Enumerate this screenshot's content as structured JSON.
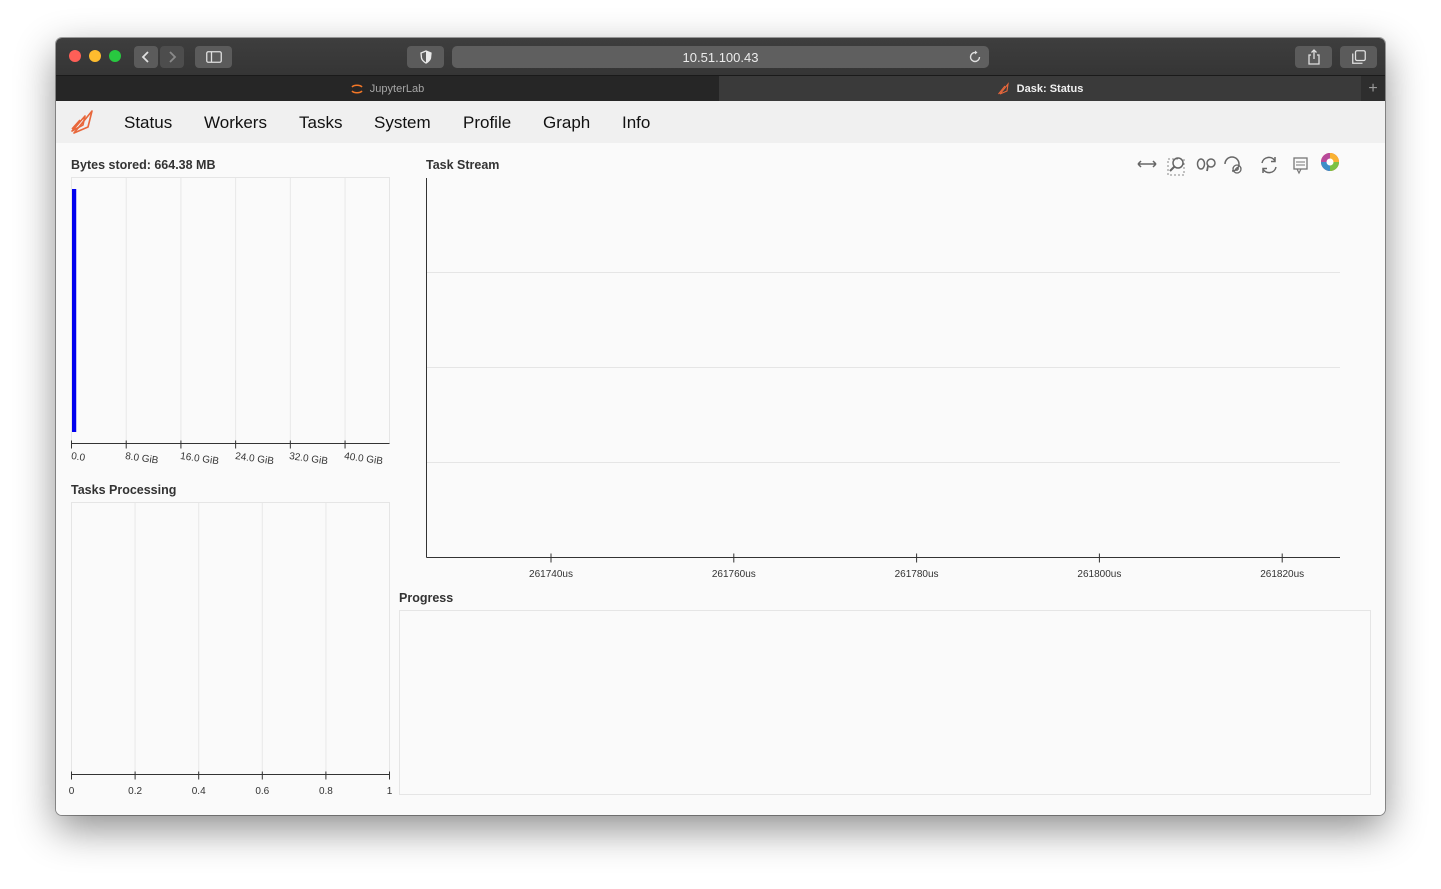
{
  "browser": {
    "url": "10.51.100.43",
    "tabs": [
      {
        "label": "JupyterLab",
        "active": false
      },
      {
        "label": "Dask: Status",
        "active": true
      }
    ],
    "new_tab_symbol": "+"
  },
  "nav": {
    "items": [
      "Status",
      "Workers",
      "Tasks",
      "System",
      "Profile",
      "Graph",
      "Info"
    ]
  },
  "panels": {
    "bytes_stored": {
      "title": "Bytes stored: 664.38 MB",
      "ticks": [
        "0.0",
        "8.0 GiB",
        "16.0 GiB",
        "24.0 GiB",
        "32.0 GiB",
        "40.0 GiB"
      ]
    },
    "tasks_processing": {
      "title": "Tasks Processing",
      "ticks": [
        "0",
        "0.2",
        "0.4",
        "0.6",
        "0.8",
        "1"
      ]
    },
    "task_stream": {
      "title": "Task Stream",
      "ticks": [
        "261740us",
        "261760us",
        "261780us",
        "261800us",
        "261820us"
      ]
    },
    "progress": {
      "title": "Progress"
    }
  },
  "toolbar_icons": [
    "pan-icon",
    "box-zoom-icon",
    "wheel-zoom-icon",
    "zoom-in-icon",
    "reset-icon",
    "hover-icon",
    "bokeh-logo-icon"
  ],
  "colors": {
    "accent": "#1f77b4",
    "bar": "#0000ee",
    "dask_orange": "#e8673b"
  },
  "chart_data": [
    {
      "type": "bar",
      "title": "Bytes stored: 664.38 MB",
      "orientation": "horizontal",
      "x_ticks": [
        "0.0",
        "8.0 GiB",
        "16.0 GiB",
        "24.0 GiB",
        "32.0 GiB",
        "40.0 GiB"
      ],
      "xlim": [
        0,
        46.5
      ],
      "values": [
        0.62
      ],
      "grid": true
    },
    {
      "type": "bar",
      "title": "Tasks Processing",
      "orientation": "horizontal",
      "x_ticks": [
        "0",
        "0.2",
        "0.4",
        "0.6",
        "0.8",
        "1"
      ],
      "xlim": [
        0,
        1
      ],
      "values": [],
      "grid": true
    },
    {
      "type": "scatter",
      "title": "Task Stream",
      "x_ticks": [
        "261740us",
        "261760us",
        "261780us",
        "261800us",
        "261820us"
      ],
      "x": [],
      "y": [],
      "grid": true
    }
  ]
}
